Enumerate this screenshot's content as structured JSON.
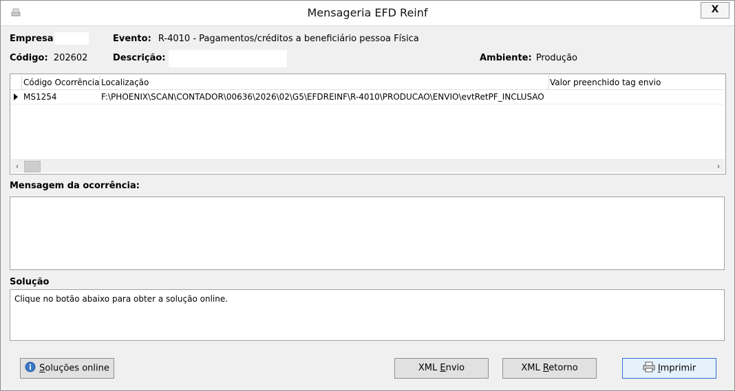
{
  "window": {
    "title": "Mensageria EFD Reinf",
    "close_label": "X"
  },
  "header": {
    "empresa_label": "Empresa:",
    "evento_label": "Evento:",
    "evento_value": "R-4010 - Pagamentos/créditos a beneficiário pessoa Física",
    "codigo_label": "Código:",
    "codigo_value": "202602",
    "descricao_label": "Descrição:",
    "ambiente_label": "Ambiente:",
    "ambiente_value": "Produção"
  },
  "grid": {
    "columns": [
      "Código Ocorrência",
      "Localização",
      "Valor preenchido tag envio"
    ],
    "rows": [
      {
        "codigo": "MS1254",
        "localizacao": "F:\\PHOENIX\\SCAN\\CONTADOR\\00636\\2026\\02\\G5\\EFDREINF\\R-4010\\PRODUCAO\\ENVIO\\evtRetPF_INCLUSAO",
        "valor": ""
      }
    ]
  },
  "mensagem": {
    "label": "Mensagem da ocorrência:",
    "text": ""
  },
  "solucao": {
    "label": "Solução",
    "text": "Clique no botão abaixo para obter a solução online."
  },
  "buttons": {
    "solucoes_online": {
      "pre": "",
      "ul": "S",
      "post": "oluções online"
    },
    "xml_envio": {
      "pre": "XML ",
      "ul": "E",
      "post": "nvio"
    },
    "xml_retorno": {
      "pre": "XML ",
      "ul": "R",
      "post": "etorno"
    },
    "imprimir": {
      "pre": "",
      "ul": "I",
      "post": "mprimir"
    }
  },
  "colors": {
    "focus_border": "#2b6fd6",
    "info_icon": "#3a78c9"
  }
}
